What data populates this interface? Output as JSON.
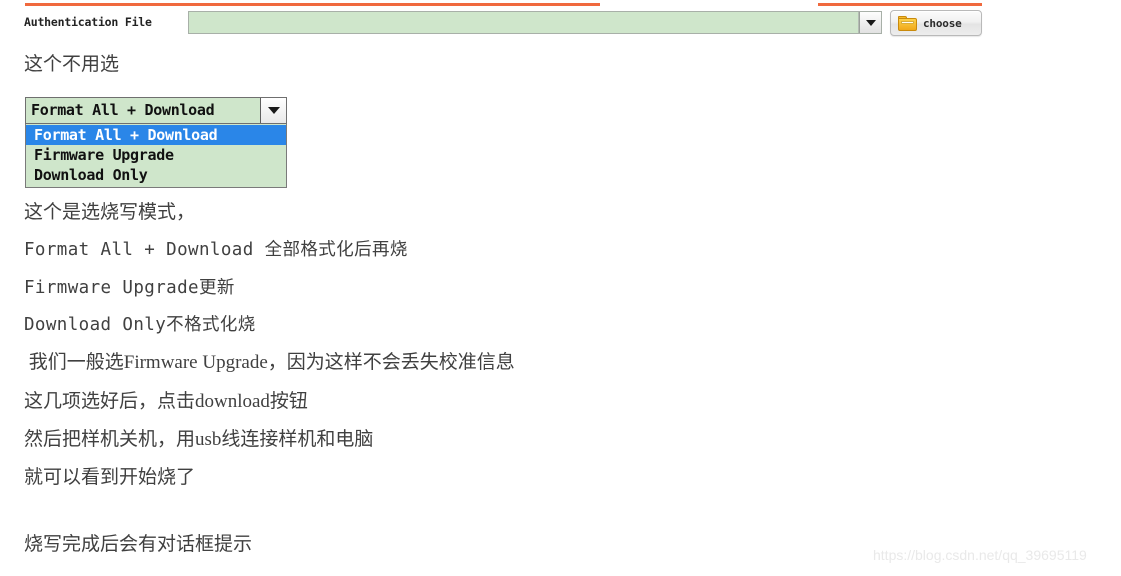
{
  "window": {
    "accent_color": "#f0693e"
  },
  "auth_row": {
    "label": "Authentication File",
    "field_value": "",
    "field_placeholder": "",
    "dropdown_icon": "chevron-down-icon",
    "choose_button": {
      "label": "choose",
      "icon": "folder-icon"
    }
  },
  "mode_select": {
    "selected_value": "Format All + Download",
    "dropdown_icon": "chevron-down-icon",
    "options": [
      {
        "label": "Format All + Download",
        "selected": true
      },
      {
        "label": "Firmware Upgrade",
        "selected": false
      },
      {
        "label": "Download Only",
        "selected": false
      }
    ],
    "highlight_color": "#2a86e8",
    "field_color": "#cfe6cb"
  },
  "notes": {
    "line_above_select": "这个不用选",
    "lines": [
      {
        "text": "这个是选烧写模式，",
        "mono": false
      },
      {
        "text": "Format All + Download 全部格式化后再烧",
        "mono": true
      },
      {
        "text": "Firmware Upgrade更新",
        "mono": true
      },
      {
        "text": "Download Only不格式化烧",
        "mono": true
      },
      {
        "text": " 我们一般选Firmware Upgrade，因为这样不会丢失校准信息",
        "mono": false
      },
      {
        "text": "这几项选好后，点击download按钮",
        "mono": false
      },
      {
        "text": "然后把样机关机，用usb线连接样机和电脑",
        "mono": false
      },
      {
        "text": "就可以看到开始烧了",
        "mono": false
      },
      {
        "text": "烧写完成后会有对话框提示",
        "mono": false
      }
    ]
  },
  "watermark": {
    "text": "https://blog.csdn.net/qq_39695119"
  }
}
